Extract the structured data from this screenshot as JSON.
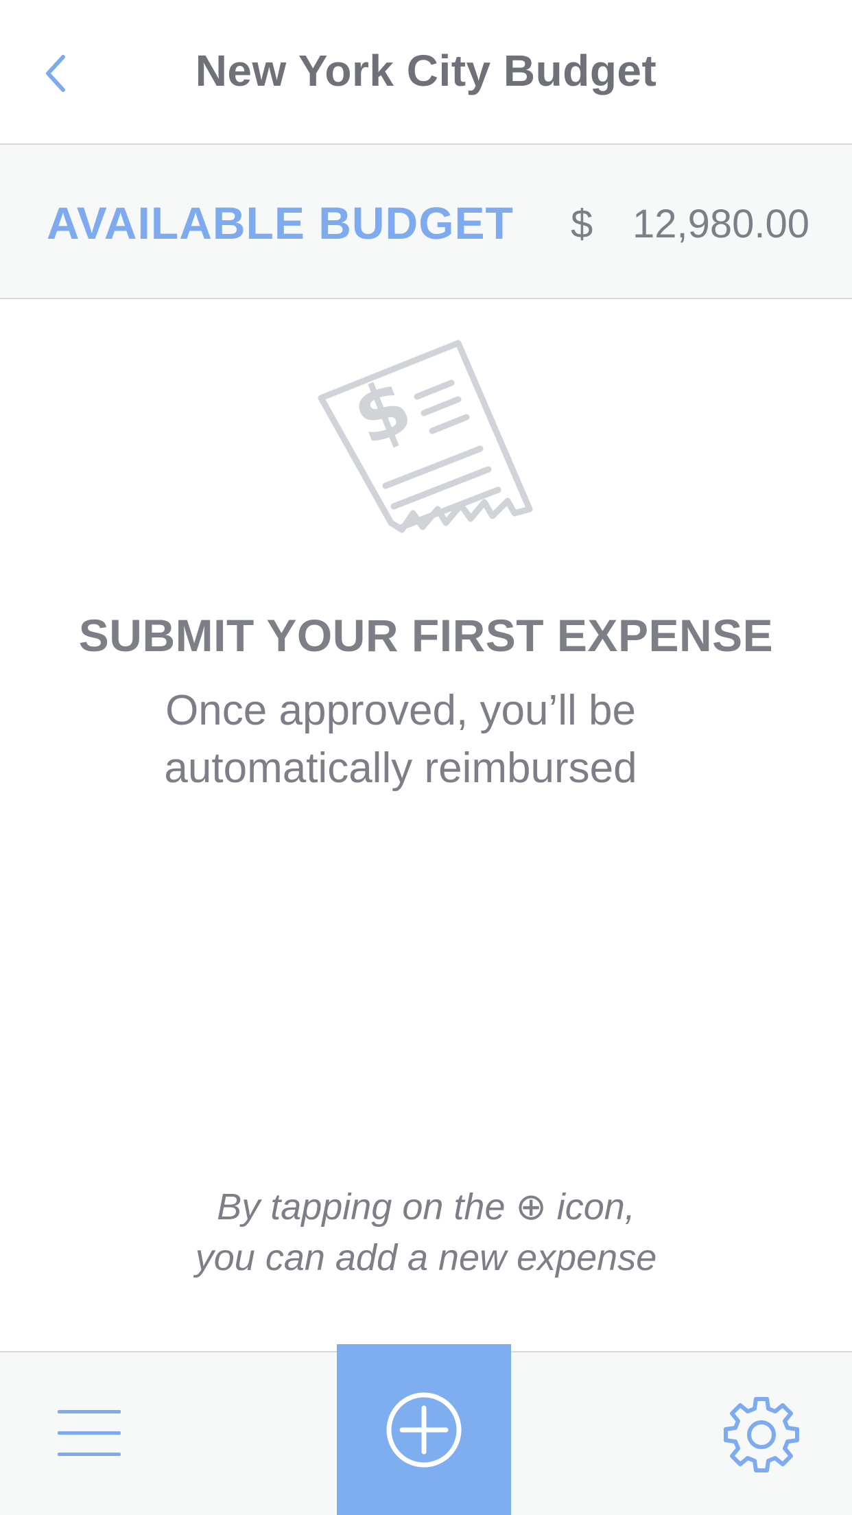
{
  "header": {
    "title": "New York City Budget",
    "back_icon": "chevron-left-icon"
  },
  "budget": {
    "label": "AVAILABLE BUDGET",
    "currency": "$",
    "amount": "12,980.00"
  },
  "empty_state": {
    "illustration_icon": "receipt-dollar-icon",
    "title": "SUBMIT YOUR FIRST EXPENSE",
    "subtitle_line1": "Once approved, you’ll be",
    "subtitle_line2": "automatically reimbursed"
  },
  "hint": {
    "line1": "By tapping on the ⊕ icon,",
    "line2": "you can add a new expense"
  },
  "toolbar": {
    "menu_icon": "hamburger-menu-icon",
    "add_icon": "plus-circle-icon",
    "settings_icon": "gear-icon"
  },
  "colors": {
    "accent": "#7eaaf0",
    "text": "#7d7f87",
    "illustration": "#d0d3d8",
    "bar_background": "#f7f8f8"
  }
}
